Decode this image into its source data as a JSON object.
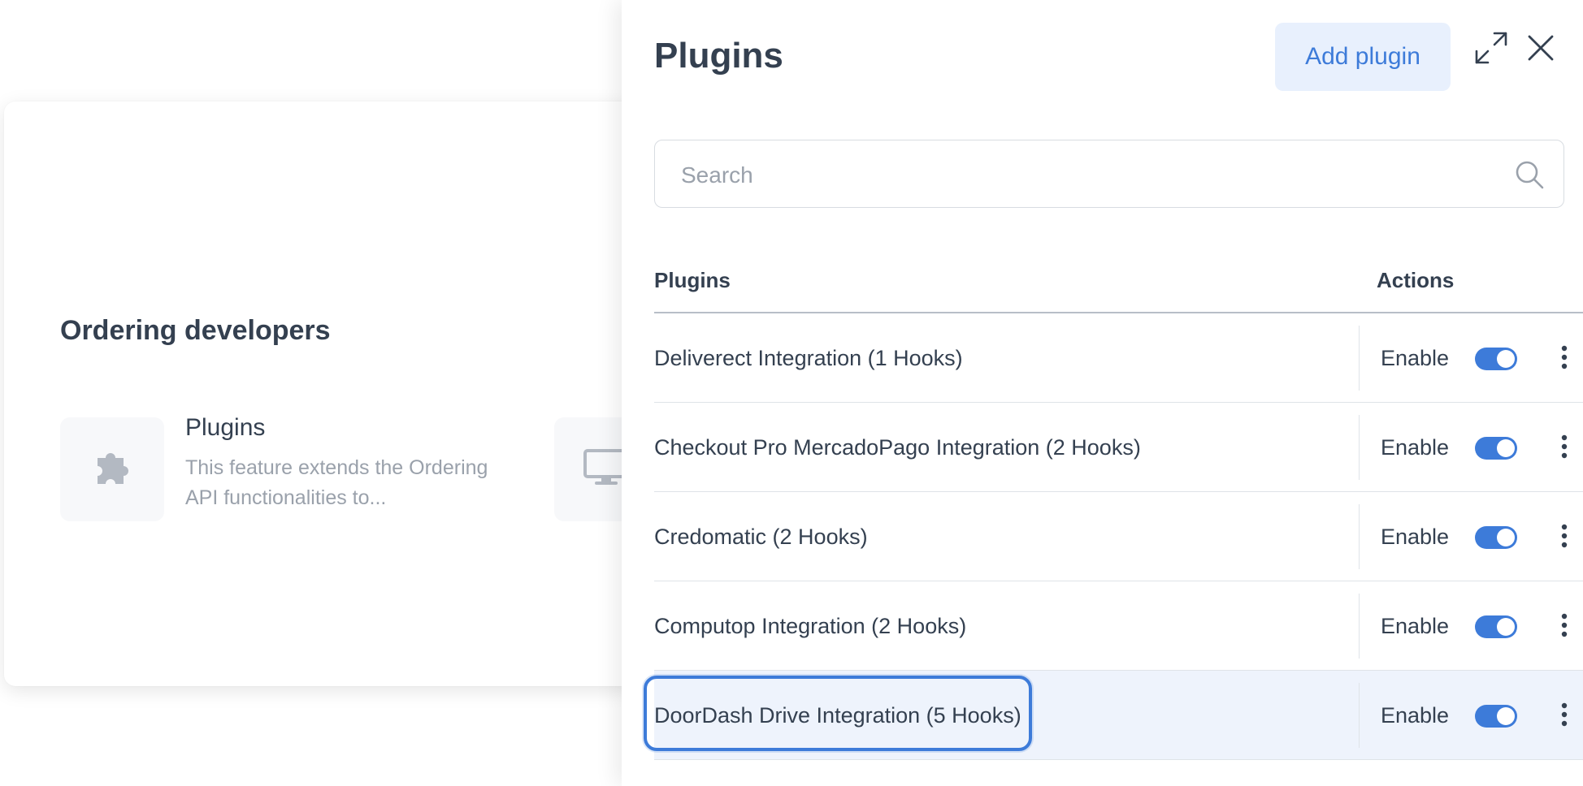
{
  "background": {
    "section_title": "Ordering developers",
    "feature": {
      "title": "Plugins",
      "description": "This feature extends the Ordering API functionalities to...",
      "icon": "puzzle-icon"
    },
    "second_feature": {
      "icon": "monitor-icon"
    }
  },
  "panel": {
    "title": "Plugins",
    "add_button_label": "Add plugin",
    "expand_icon": "expand-icon",
    "close_icon": "close-icon",
    "search": {
      "placeholder": "Search",
      "value": ""
    },
    "table": {
      "headers": {
        "plugins": "Plugins",
        "actions": "Actions"
      },
      "rows": [
        {
          "name": "Deliverect Integration (1 Hooks)",
          "enable_label": "Enable",
          "enabled": true
        },
        {
          "name": "Checkout Pro MercadoPago Integration (2 Hooks)",
          "enable_label": "Enable",
          "enabled": true
        },
        {
          "name": "Credomatic (2 Hooks)",
          "enable_label": "Enable",
          "enabled": true
        },
        {
          "name": "Computop Integration (2 Hooks)",
          "enable_label": "Enable",
          "enabled": true
        },
        {
          "name": "DoorDash Drive Integration (5 Hooks)",
          "enable_label": "Enable",
          "enabled": true,
          "highlighted": true
        }
      ]
    }
  },
  "colors": {
    "accent": "#3d7bd9",
    "accent_light": "#e8f0fd",
    "text": "#344050",
    "muted": "#9aa1ab"
  }
}
